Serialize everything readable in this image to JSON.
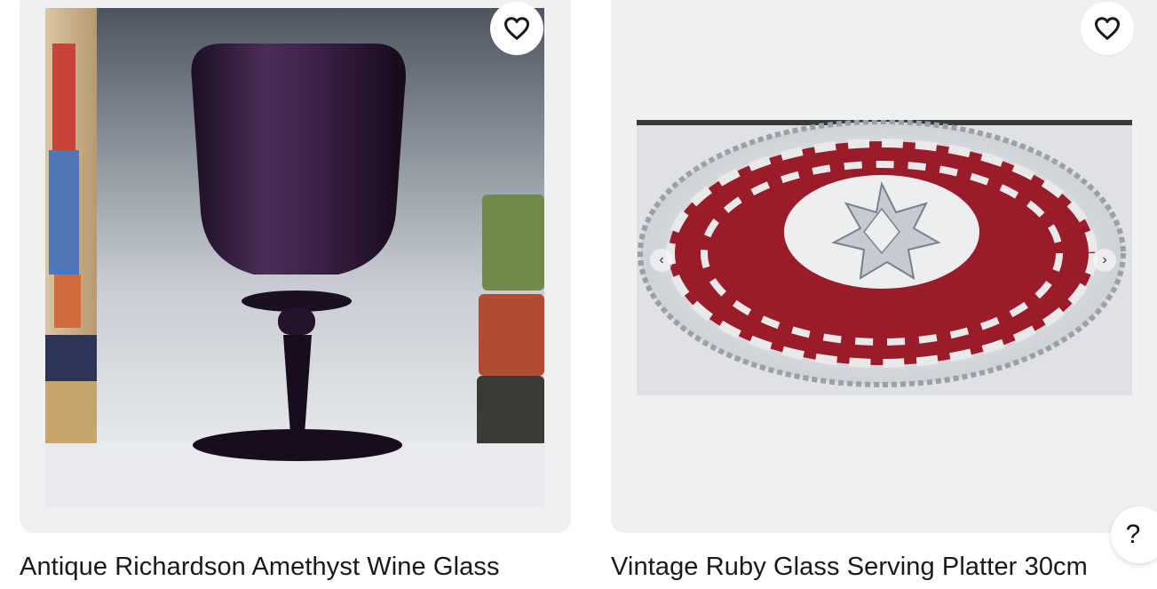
{
  "listings": [
    {
      "title": "Antique Richardson Amethyst Wine Glass",
      "image_alt": "Amethyst wine glass beside stacked books",
      "favorite_icon": "heart-outline-icon"
    },
    {
      "title": "Vintage Ruby Glass Serving Platter 30cm",
      "image_alt": "Round clear glass platter with ruby red leaf pattern and star center",
      "favorite_icon": "heart-outline-icon",
      "prev_icon": "chevron-left-icon",
      "next_icon": "chevron-right-icon"
    }
  ],
  "help": {
    "label": "?",
    "icon": "help-icon"
  },
  "colors": {
    "card_bg": "#f0f0f0",
    "amethyst": "#2a1630",
    "ruby": "#9a1c2a",
    "text": "#191919"
  }
}
